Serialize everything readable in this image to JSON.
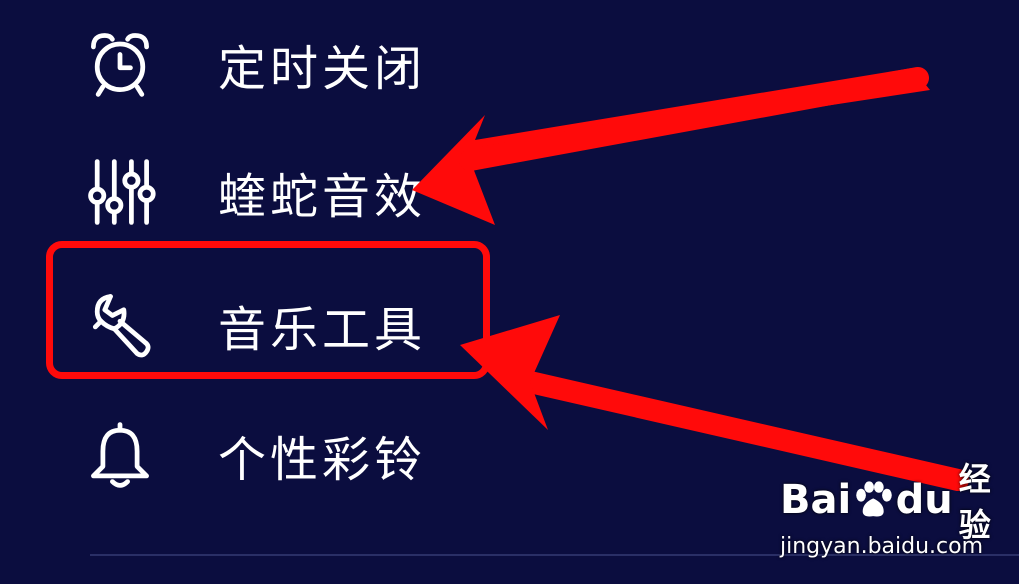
{
  "menu": {
    "items": [
      {
        "label": "定时关闭",
        "icon": "alarm-clock-icon"
      },
      {
        "label": "蝰蛇音效",
        "icon": "equalizer-icon"
      },
      {
        "label": "音乐工具",
        "icon": "wrench-icon"
      },
      {
        "label": "个性彩铃",
        "icon": "bell-icon"
      }
    ]
  },
  "annotation": {
    "highlight_color": "#ff0a0a",
    "highlighted_item": "音乐工具"
  },
  "watermark": {
    "logo_prefix": "Bai",
    "logo_suffix": "du",
    "logo_cn": "经验",
    "url": "jingyan.baidu.com"
  },
  "colors": {
    "background": "#0b0d3f",
    "text": "#ffffff",
    "arrow": "#ff0a0a"
  }
}
